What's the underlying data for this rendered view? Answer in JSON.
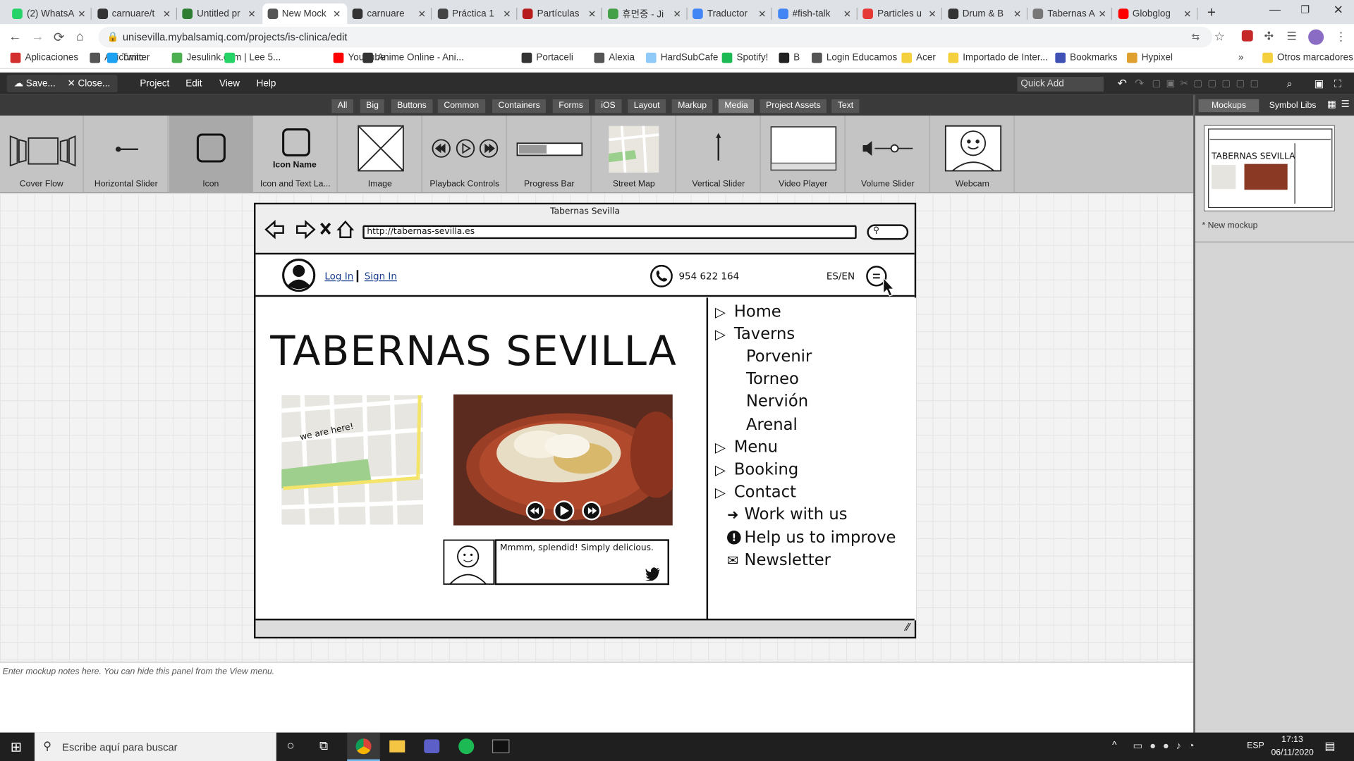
{
  "browser": {
    "tabs": [
      {
        "title": "(2) WhatsA",
        "color": "#25d366"
      },
      {
        "title": "carnuare/t",
        "color": "#333333"
      },
      {
        "title": "Untitled pr",
        "color": "#2e7d32"
      },
      {
        "title": "New Mock",
        "color": "#555555"
      },
      {
        "title": "carnuare",
        "color": "#333333"
      },
      {
        "title": "Práctica 1",
        "color": "#444444"
      },
      {
        "title": "Partículas",
        "color": "#b71c1c"
      },
      {
        "title": "휴먼중 - Ji",
        "color": "#43a047"
      },
      {
        "title": "Traductor",
        "color": "#4285f4"
      },
      {
        "title": "#fish-talk",
        "color": "#4285f4"
      },
      {
        "title": "Particles u",
        "color": "#e53935"
      },
      {
        "title": "Drum & B",
        "color": "#333333"
      },
      {
        "title": "Tabernas A",
        "color": "#777777"
      },
      {
        "title": "Globglog",
        "color": "#ff0000"
      }
    ],
    "url": "unisevilla.mybalsamiq.com/projects/is-clinica/edit",
    "bookmarks": [
      {
        "label": "Aplicaciones",
        "color": "#d32f2f"
      },
      {
        "label": "Articomic",
        "color": "#555555"
      },
      {
        "label": "Twitter",
        "color": "#1da1f2"
      },
      {
        "label": "Jesulink.com | Lee 5...",
        "color": "#4caf50"
      },
      {
        "label": "",
        "color": "#25d366"
      },
      {
        "label": "YouTube",
        "color": "#ff0000"
      },
      {
        "label": "Anime Online - Ani...",
        "color": "#333333"
      },
      {
        "label": "Portaceli",
        "color": "#333333"
      },
      {
        "label": "Alexia",
        "color": "#555555"
      },
      {
        "label": "HardSubCafe",
        "color": "#90caf9"
      },
      {
        "label": "Spotify!",
        "color": "#1db954"
      },
      {
        "label": "B",
        "color": "#222222"
      },
      {
        "label": "Login Educamos",
        "color": "#555555"
      },
      {
        "label": "Acer",
        "color": "#f4d03f"
      },
      {
        "label": "Importado de Inter...",
        "color": "#f4d03f"
      },
      {
        "label": "Bookmarks",
        "color": "#3f51b5"
      },
      {
        "label": "Hypixel",
        "color": "#e0a030"
      }
    ],
    "other_bookmarks": "Otros marcadores",
    "more": "»"
  },
  "balsamiq": {
    "save": "Save...",
    "close": "Close...",
    "menus": [
      "Project",
      "Edit",
      "View",
      "Help"
    ],
    "quick_add": "Quick Add",
    "filters": [
      "All",
      "Big",
      "Buttons",
      "Common",
      "Containers",
      "Forms",
      "iOS",
      "Layout",
      "Markup",
      "Media",
      "Project Assets",
      "Text"
    ],
    "selected_filter": "Media",
    "library": [
      "Cover Flow",
      "Horizontal Slider",
      "Icon",
      "Icon and Text La...",
      "Image",
      "Playback Controls",
      "Progress Bar",
      "Street Map",
      "Vertical Slider",
      "Video Player",
      "Volume Slider",
      "Webcam"
    ],
    "icon_name_label": "Icon Name",
    "panel_tabs": [
      "Mockups",
      "Symbol Libs"
    ],
    "mockup_item": "* New mockup",
    "notes_placeholder": "Enter mockup notes here. You can hide this panel from the View menu."
  },
  "mockup": {
    "window_title": "Tabernas Sevilla",
    "url": "http://tabernas-sevilla.es",
    "login": "Log In",
    "signin": "Sign In",
    "phone": "954 622 164",
    "lang": "ES/EN",
    "heading": "TABERNAS SEVILLA",
    "map_label": "we are here!",
    "review": "Mmmm, splendid! Simply delicious.",
    "menu": [
      {
        "label": "Home",
        "icon": "triangle"
      },
      {
        "label": "Taverns",
        "icon": "triangle"
      },
      {
        "label": "Porvenir",
        "icon": ""
      },
      {
        "label": "Torneo",
        "icon": ""
      },
      {
        "label": "Nervión",
        "icon": ""
      },
      {
        "label": "Arenal",
        "icon": ""
      },
      {
        "label": "Menu",
        "icon": "triangle"
      },
      {
        "label": "Booking",
        "icon": "triangle"
      },
      {
        "label": "Contact",
        "icon": "triangle"
      },
      {
        "label": "Work with us",
        "icon": "sign-in"
      },
      {
        "label": "Help us to improve",
        "icon": "exclamation"
      },
      {
        "label": "Newsletter",
        "icon": "envelope"
      }
    ]
  },
  "taskbar": {
    "search": "Escribe aquí para buscar",
    "lang": "ESP",
    "time": "17:13",
    "date": "06/11/2020"
  }
}
